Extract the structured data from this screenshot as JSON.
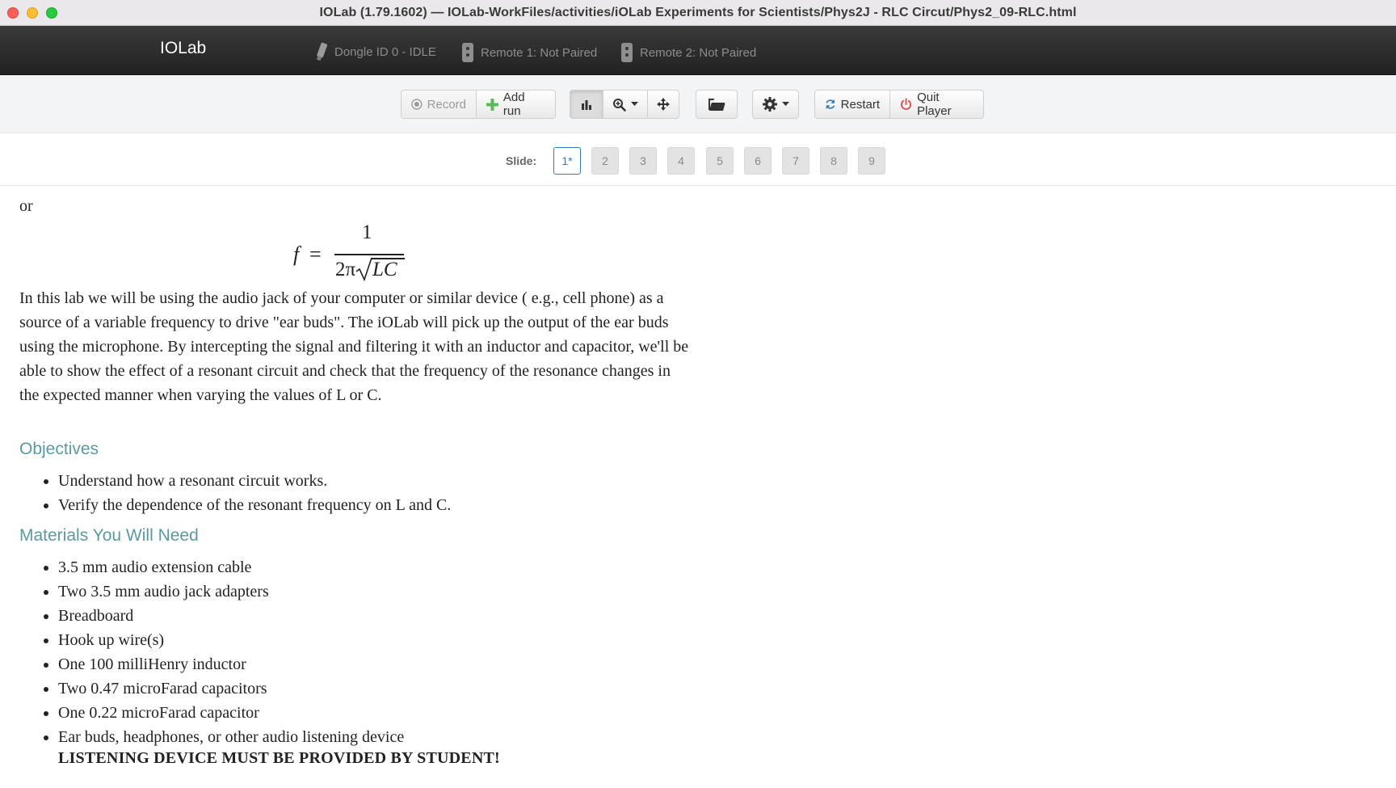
{
  "window": {
    "title": "IOLab (1.79.1602) — IOLab-WorkFiles/activities/iOLab Experiments for Scientists/Phys2J - RLC Circut/Phys2_09-RLC.html"
  },
  "header": {
    "brand": "IOLab",
    "devices": [
      {
        "icon": "dongle-icon",
        "label": "Dongle ID 0 - IDLE"
      },
      {
        "icon": "remote-icon",
        "label": "Remote 1: Not Paired"
      },
      {
        "icon": "remote-icon",
        "label": "Remote 2: Not Paired"
      }
    ]
  },
  "toolbar": {
    "record_label": "Record",
    "add_run_label": "Add run",
    "restart_label": "Restart",
    "quit_label": "Quit Player",
    "icons": [
      "record-icon",
      "plus-icon",
      "bar-chart-icon",
      "zoom-icon",
      "move-icon",
      "folder-icon",
      "gear-icon",
      "refresh-icon",
      "power-icon"
    ]
  },
  "slides": {
    "label": "Slide:",
    "items": [
      "1*",
      "2",
      "3",
      "4",
      "5",
      "6",
      "7",
      "8",
      "9"
    ],
    "current": "1*"
  },
  "content": {
    "or": "or",
    "formula": {
      "lhs": "f",
      "eq": "=",
      "numerator": "1",
      "den_prefix": "2π",
      "den_radicand": "LC"
    },
    "paragraph": "In this lab we will be using the audio jack of your computer or similar device ( e.g., cell phone) as a source of a variable frequency to drive \"ear buds\". The iOLab will pick up the output of the ear buds using the microphone. By intercepting the signal and filtering it with an inductor and capacitor, we'll be able to show the effect of a resonant circuit and check that the frequency of the resonance changes in the expected manner when varying the values of L or C.",
    "objectives_heading": "Objectives",
    "objectives": [
      "Understand how a resonant circuit works.",
      "Verify the dependence of the resonant frequency on L and C."
    ],
    "materials_heading": "Materials You Will Need",
    "materials": [
      "3.5 mm audio extension cable",
      "Two 3.5 mm audio jack adapters",
      "Breadboard",
      "Hook up wire(s)",
      "One 100 milliHenry inductor",
      "Two 0.47 microFarad capacitors",
      "One 0.22 microFarad capacitor",
      "Ear buds, headphones, or other audio listening device"
    ],
    "warning": "LISTENING DEVICE MUST BE PROVIDED BY STUDENT!"
  },
  "colors": {
    "heading": "#5b9aa0",
    "slide_active": "#337ab7",
    "quit_icon": "#d9534f",
    "restart_icon": "#337ab7",
    "add_icon": "#5cb85c"
  }
}
